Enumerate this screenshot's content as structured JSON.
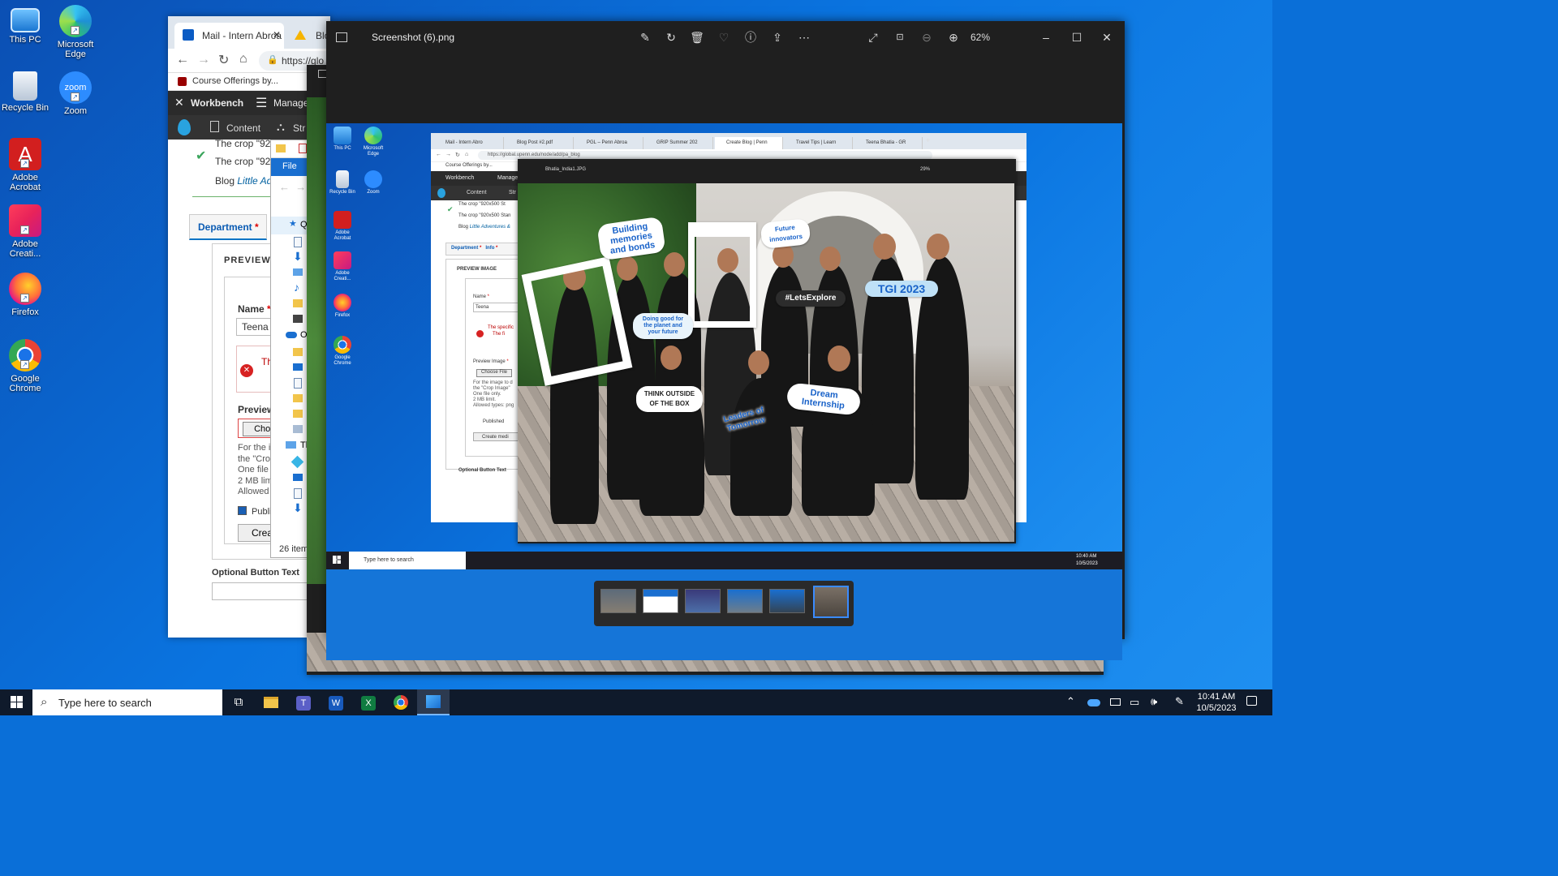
{
  "desktop": {
    "icons": [
      {
        "label": "This PC",
        "icon": "computer-icon"
      },
      {
        "label": "Microsoft Edge",
        "icon": "edge-icon"
      },
      {
        "label": "Recycle Bin",
        "icon": "recycle-bin-icon"
      },
      {
        "label": "Zoom",
        "icon": "zoom-icon"
      },
      {
        "label": "Adobe Acrobat",
        "icon": "acrobat-icon"
      },
      {
        "label": "Adobe Creati...",
        "icon": "creative-cloud-icon"
      },
      {
        "label": "Firefox",
        "icon": "firefox-icon"
      },
      {
        "label": "Google Chrome",
        "icon": "chrome-icon"
      }
    ]
  },
  "browser": {
    "tabs": [
      {
        "label": "Mail - Intern Abroa"
      },
      {
        "label": "Blog"
      }
    ],
    "address": "https://glo",
    "bookmark": "Course Offerings by...",
    "admin_bar": {
      "workbench": "Workbench",
      "manage": "Manage",
      "content": "Content",
      "structure": "Str"
    },
    "messages": [
      "The crop \"920",
      "The crop \"920x",
      "Blog"
    ],
    "blog_link": "Little Adve",
    "tabs_form": {
      "department": "Department",
      "required": "*"
    },
    "preview_heading": "PREVIEW I",
    "name_label": "Name",
    "name_value": "Teena",
    "error_text": "Th",
    "preview_label": "Preview",
    "choose_file": "Choos",
    "help": [
      "For the im",
      "the \"Crop",
      "One file o",
      "2 MB lim",
      "Allowed t"
    ],
    "published": "Publi",
    "create_btn": "Crea",
    "optional_button_text": "Optional Button Text"
  },
  "explorer": {
    "menu_file": "File",
    "item_quick": "Q",
    "item_one": "O",
    "item_this": "Th",
    "status": "26 item"
  },
  "photos": {
    "title": "Screenshot (6).png",
    "zoom": "62%",
    "inner": {
      "tabs": [
        "Mail - Intern Abro",
        "Blog Post #2.pdf",
        "PGL – Penn Abroa",
        "GRIP Summer 202",
        "Create Blog | Penn",
        "Travel Tips | Learn",
        "Teena Bhatia - GR"
      ],
      "address": "https://global.upenn.edu/node/add/pa_blog",
      "bookmark": "Course Offerings by...",
      "workbench": "Workbench",
      "manage": "Manage",
      "content": "Content",
      "structure": "Str",
      "messages": [
        "The crop \"920x500 St",
        "The crop \"920x500 Stan"
      ],
      "blog": "Blog",
      "blog_link": "Little Adventures &",
      "department": "Department",
      "info": "Info",
      "preview_image": "PREVIEW IMAGE",
      "name": "Name",
      "name_value": "Teena",
      "error1": "The specific",
      "error2": "The fi",
      "preview_image_label": "Preview Image",
      "choose_file": "Choose File",
      "help": [
        "For the image to d",
        "the \"Crop Image\"",
        "One file only.",
        "2 MB limit.",
        "Allowed types: png"
      ],
      "published": "Published",
      "create_media": "Create medi",
      "optional_button_text": "Optional Button Text",
      "photo_title": "Bhatia_India1.JPG",
      "photo_zoom": "29%",
      "search": "Type here to search",
      "time": "10:40 AM",
      "date": "10/5/2023",
      "desktop_icons": [
        "This PC",
        "Microsoft Edge",
        "Recycle Bin",
        "Zoom",
        "Adobe Acrobat",
        "Adobe Creati...",
        "Firefox",
        "Google Chrome"
      ]
    },
    "signs": {
      "building": "Building memories and bonds",
      "future": "Future innovators",
      "letsexplore": "#LetsExplore",
      "tgi": "TGI 2023",
      "doing_good": "Doing good for the planet and your future",
      "think": "THINK OUTSIDE OF THE BOX",
      "leaders": "Leaders of Tomorrow",
      "dream": "Dream Internship"
    },
    "thumb_count": 6
  },
  "taskbar": {
    "search_placeholder": "Type here to search",
    "time": "10:41 AM",
    "date": "10/5/2023"
  },
  "colors": {
    "accent": "#0078d4",
    "taskbar": "#0f1a2b",
    "photos_bg": "#1f1f1f"
  }
}
